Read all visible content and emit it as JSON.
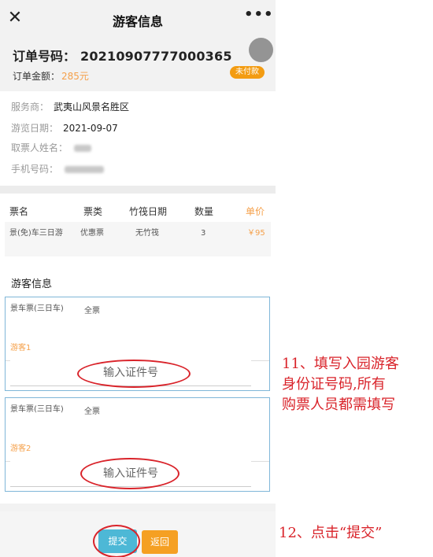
{
  "nav": {
    "close_glyph": "✕",
    "title": "游客信息",
    "more_glyph": "•••"
  },
  "order": {
    "number_label": "订单号码：",
    "number_value": "20210907777000365",
    "amount_label": "订单金额：",
    "amount_value": "285元",
    "status_badge": "未付款"
  },
  "info": {
    "provider_label": "服务商：",
    "provider_value": "武夷山风景名胜区",
    "date_label": "游览日期：",
    "date_value": "2021-09-07",
    "name_label": "取票人姓名：",
    "phone_label": "手机号码："
  },
  "tickets": {
    "headers": [
      "票名",
      "票类",
      "竹筏日期",
      "数量",
      "单价"
    ],
    "rows": [
      {
        "name": "景(免)车三日游",
        "type": "优惠票",
        "raft_date": "无竹筏",
        "qty": "3",
        "price": "￥95"
      }
    ]
  },
  "visitors": {
    "title": "游客信息",
    "items": [
      {
        "ticket": "景车票(三日车)",
        "kind": "全票",
        "label": "游客1",
        "placeholder": "输入证件号"
      },
      {
        "ticket": "景车票(三日车)",
        "kind": "全票",
        "label": "游客2",
        "placeholder": "输入证件号"
      }
    ]
  },
  "actions": {
    "submit": "提交",
    "back": "返回"
  },
  "annotations": {
    "step11_lines": [
      "11、填写入园游客",
      "身份证号码,所有",
      "购票人员都需填写"
    ],
    "step12": "12、点击“提交”"
  },
  "colors": {
    "accent_orange": "#f5a04a",
    "submit_blue": "#4db8d6",
    "annotation_red": "#d9232a"
  }
}
